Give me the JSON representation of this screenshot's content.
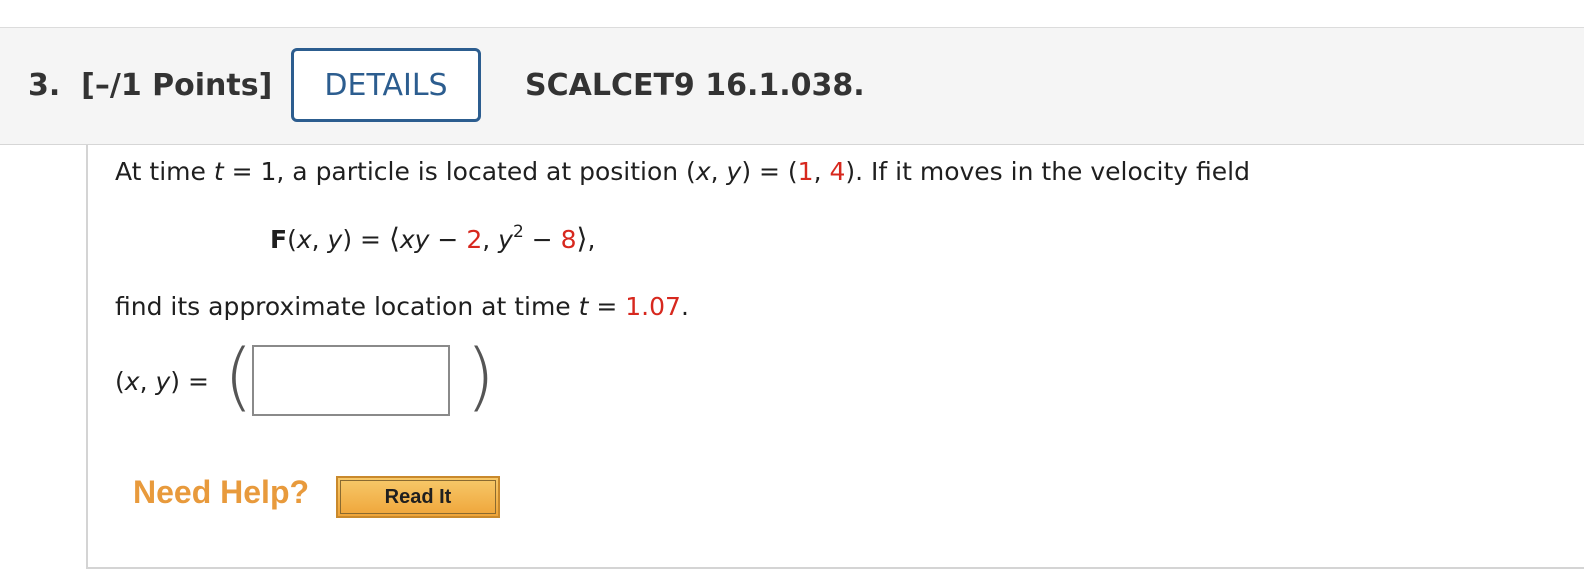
{
  "header": {
    "question_number": "3.",
    "points": "[–/1 Points]",
    "details_label": "DETAILS",
    "question_code": "SCALCET9 16.1.038."
  },
  "problem": {
    "intro_prefix": "At time ",
    "t_var": "t",
    "t_eq_one": " = 1, a particle is located at position (",
    "x_var": "x",
    "comma": ", ",
    "y_var": "y",
    "eq_open": ") = (",
    "x0": "1",
    "x0_sep": ", ",
    "y0": "4",
    "intro_suffix": "). If it moves in the velocity field",
    "field_name": "F",
    "field_args_open": "(",
    "field_args_close": ") = ",
    "lang": "⟨",
    "xy": "xy",
    "minus": " − ",
    "c1": "2",
    "sep2": ", ",
    "y2_base": "y",
    "y2_exp": "2",
    "c2": "8",
    "rang": "⟩",
    "trail_comma": ",",
    "find_prefix": "find its approximate location at time ",
    "eq": " = ",
    "t1": "1.07",
    "period": "."
  },
  "answer": {
    "label_open": "(",
    "label_close": ") =",
    "paren_left": "(",
    "paren_right": ")",
    "input_value": "",
    "input_placeholder": ""
  },
  "help": {
    "need_help": "Need Help?",
    "read_it": "Read It"
  }
}
